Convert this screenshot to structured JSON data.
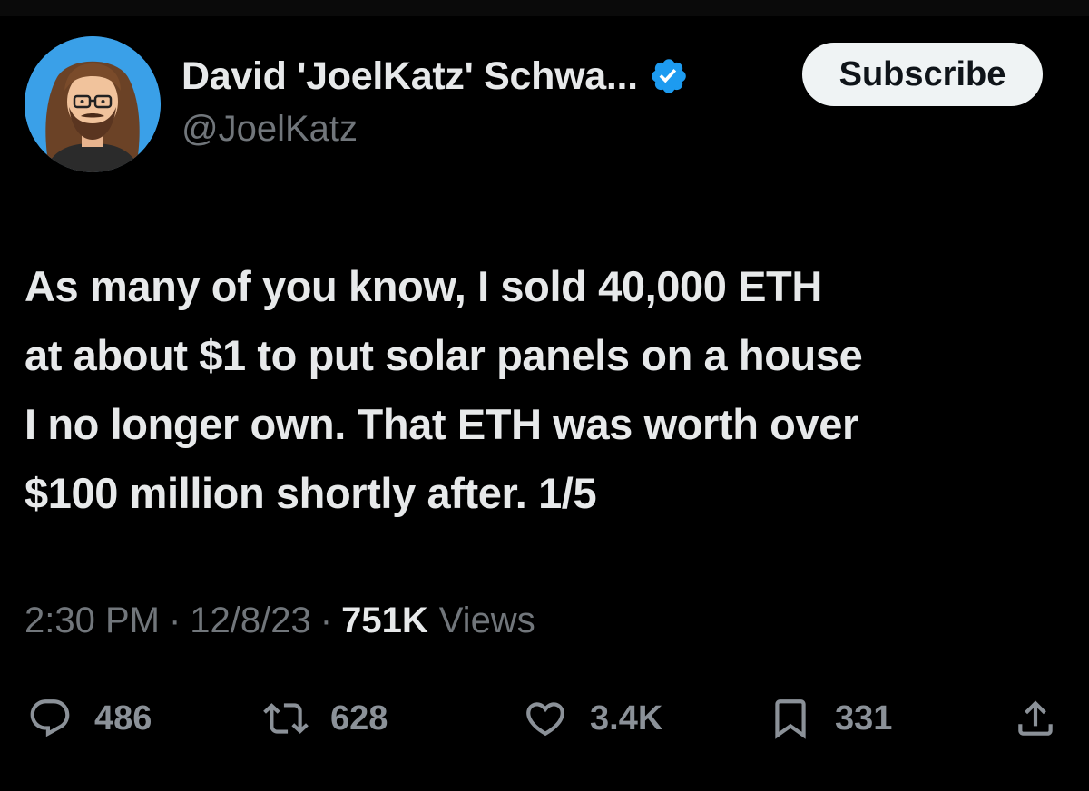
{
  "tweet": {
    "author": {
      "name": "David 'JoelKatz' Schwa...",
      "handle": "@JoelKatz",
      "verified": true,
      "avatar": "cartoon-portrait-avatar"
    },
    "subscribe_label": "Subscribe",
    "text_lines": [
      "As many of you know, I sold 40,000 ETH",
      "at about $1 to put solar panels on a house",
      "I no longer own. That ETH was worth over",
      "$100 million shortly after. 1/5"
    ],
    "meta": {
      "time": "2:30 PM",
      "separator": "·",
      "date": "12/8/23",
      "views_count": "751K",
      "views_label": "Views"
    },
    "actions": {
      "replies": "486",
      "retweets": "628",
      "likes": "3.4K",
      "bookmarks": "331"
    }
  },
  "icons": {
    "reply": "reply-icon",
    "retweet": "retweet-icon",
    "like": "heart-icon",
    "bookmark": "bookmark-icon",
    "share": "share-icon",
    "verified": "verified-badge-icon"
  },
  "colors": {
    "background": "#000000",
    "primary_text": "#e7e9ea",
    "secondary_text": "#71767b",
    "verified_blue": "#1d9bf0",
    "subscribe_bg": "#eff3f4"
  }
}
